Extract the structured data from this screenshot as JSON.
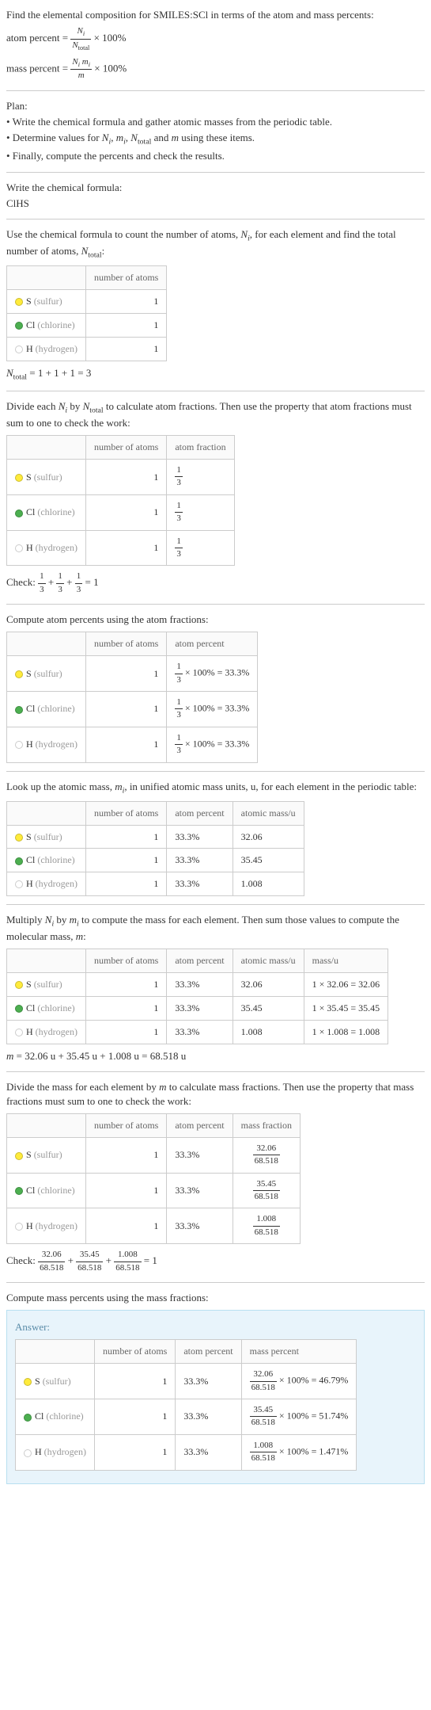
{
  "intro": {
    "line1": "Find the elemental composition for SMILES:SCl in terms of the atom and mass percents:",
    "atom_percent_label": "atom percent = ",
    "atom_percent_frac_num": "N_i",
    "atom_percent_frac_den": "N_total",
    "times100": " × 100%",
    "mass_percent_label": "mass percent = ",
    "mass_percent_frac_num": "N_i m_i",
    "mass_percent_frac_den": "m"
  },
  "plan": {
    "heading": "Plan:",
    "b1": "• Write the chemical formula and gather atomic masses from the periodic table.",
    "b2_a": "• Determine values for ",
    "b2_b": " using these items.",
    "b3": "• Finally, compute the percents and check the results."
  },
  "formula_section": {
    "heading": "Write the chemical formula:",
    "formula": "ClHS"
  },
  "count_section": {
    "text_a": "Use the chemical formula to count the number of atoms, ",
    "text_b": ", for each element and find the total number of atoms, ",
    "text_c": ":",
    "hdr_atoms": "number of atoms",
    "s_label": "S ",
    "s_paren": "(sulfur)",
    "cl_label": "Cl ",
    "cl_paren": "(chlorine)",
    "h_label": "H ",
    "h_paren": "(hydrogen)",
    "s_n": "1",
    "cl_n": "1",
    "h_n": "1",
    "ntotal_eq": " = 1 + 1 + 1 = 3"
  },
  "atomfrac_section": {
    "text": "Divide each N_i by N_total to calculate atom fractions. Then use the property that atom fractions must sum to one to check the work:",
    "hdr_atoms": "number of atoms",
    "hdr_frac": "atom fraction",
    "one_third_num": "1",
    "one_third_den": "3",
    "check_label": "Check: ",
    "check_eq": " = 1"
  },
  "atompct_section": {
    "text": "Compute atom percents using the atom fractions:",
    "hdr_atoms": "number of atoms",
    "hdr_pct": "atom percent",
    "pct_expr": " × 100% = 33.3%"
  },
  "mass_section": {
    "text_a": "Look up the atomic mass, ",
    "text_b": ", in unified atomic mass units, u, for each element in the periodic table:",
    "hdr_atoms": "number of atoms",
    "hdr_pct": "atom percent",
    "hdr_mass": "atomic mass/u",
    "s_mass": "32.06",
    "cl_mass": "35.45",
    "h_mass": "1.008",
    "pct": "33.3%"
  },
  "molmass_section": {
    "text_a": "Multiply ",
    "text_b": " by ",
    "text_c": " to compute the mass for each element. Then sum those values to compute the molecular mass, ",
    "text_d": ":",
    "hdr_atoms": "number of atoms",
    "hdr_pct": "atom percent",
    "hdr_amass": "atomic mass/u",
    "hdr_mass": "mass/u",
    "s_calc": "1 × 32.06 = 32.06",
    "cl_calc": "1 × 35.45 = 35.45",
    "h_calc": "1 × 1.008 = 1.008",
    "m_eq": " = 32.06 u + 35.45 u + 1.008 u = 68.518 u"
  },
  "massfrac_section": {
    "text": "Divide the mass for each element by m to calculate mass fractions. Then use the property that mass fractions must sum to one to check the work:",
    "hdr_atoms": "number of atoms",
    "hdr_pct": "atom percent",
    "hdr_frac": "mass fraction",
    "s_num": "32.06",
    "cl_num": "35.45",
    "h_num": "1.008",
    "den": "68.518",
    "check_label": "Check: ",
    "check_eq": " = 1"
  },
  "answer_section": {
    "text": "Compute mass percents using the mass fractions:",
    "label": "Answer:",
    "hdr_atoms": "number of atoms",
    "hdr_apct": "atom percent",
    "hdr_mpct": "mass percent",
    "pct": "33.3%",
    "s_num": "32.06",
    "cl_num": "35.45",
    "h_num": "1.008",
    "den": "68.518",
    "s_res": " × 100% = 46.79%",
    "cl_res": " × 100% = 51.74%",
    "h_res": " × 100% = 1.471%"
  }
}
